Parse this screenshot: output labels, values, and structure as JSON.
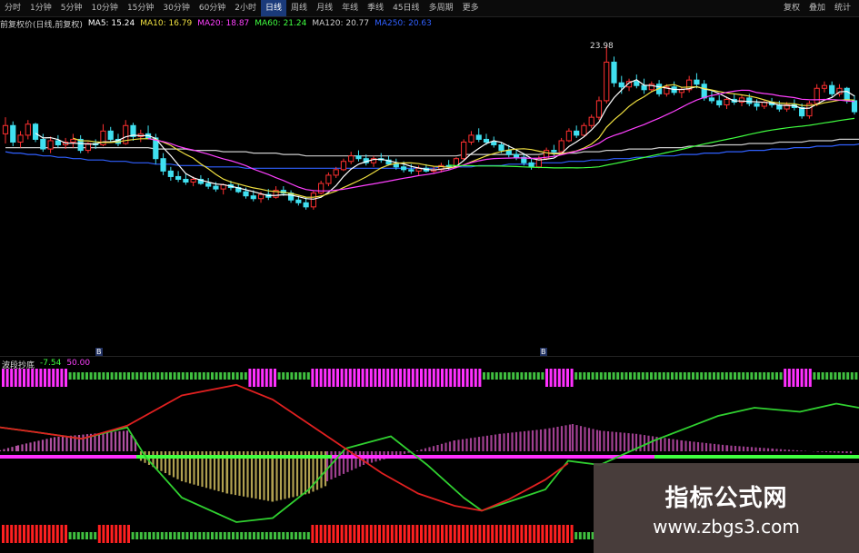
{
  "toolbar": {
    "items": [
      "分时",
      "1分钟",
      "5分钟",
      "10分钟",
      "15分钟",
      "30分钟",
      "60分钟",
      "2小时",
      "日线",
      "周线",
      "月线",
      "年线",
      "季线",
      "45日线",
      "多周期",
      "更多"
    ],
    "active_index": 8,
    "right_items": [
      "复权",
      "叠加",
      "统计"
    ]
  },
  "legend": {
    "title": "前复权价(日线,前复权)",
    "ma5": "MA5: 15.24",
    "ma10": "MA10: 16.79",
    "ma20": "MA20: 18.87",
    "ma60": "MA60: 21.24",
    "ma120": "MA120: 20.77",
    "ma250": "MA250: 20.63",
    "colors": {
      "ma5": "#ffffff",
      "ma10": "#f0e040",
      "ma20": "#ff40ff",
      "ma60": "#40ff40",
      "ma120": "#cccccc",
      "ma250": "#3060ff"
    }
  },
  "price_label": "23.98",
  "indicator": {
    "name": "波段抄底",
    "v1": "-7.54",
    "v2": "50.00",
    "flag1": "B",
    "flag2": "B"
  },
  "watermark": {
    "title": "指标公式网",
    "url": "www.zbgs3.com"
  },
  "chart_data": {
    "type": "candlestick",
    "note_series": [
      "candles",
      "ma5",
      "ma10",
      "ma20",
      "ma60",
      "ma250",
      "osc_red",
      "osc_green",
      "hist"
    ],
    "candles": [
      [
        17.6,
        18.8,
        16.9,
        18.2
      ],
      [
        18.2,
        18.5,
        16.7,
        17.0
      ],
      [
        17.0,
        17.8,
        16.6,
        17.5
      ],
      [
        17.5,
        18.6,
        17.2,
        18.3
      ],
      [
        18.3,
        18.4,
        17.0,
        17.2
      ],
      [
        17.2,
        17.6,
        16.3,
        16.5
      ],
      [
        16.5,
        17.4,
        16.2,
        17.1
      ],
      [
        17.1,
        17.5,
        16.6,
        16.8
      ],
      [
        16.8,
        17.3,
        16.5,
        17.0
      ],
      [
        17.0,
        17.6,
        16.6,
        17.2
      ],
      [
        17.2,
        17.5,
        16.2,
        16.4
      ],
      [
        16.4,
        17.0,
        16.2,
        16.9
      ],
      [
        16.9,
        17.2,
        16.5,
        16.8
      ],
      [
        16.8,
        18.3,
        16.7,
        17.8
      ],
      [
        17.8,
        18.1,
        17.0,
        17.2
      ],
      [
        17.2,
        17.6,
        16.7,
        16.9
      ],
      [
        16.9,
        18.6,
        16.8,
        18.2
      ],
      [
        18.2,
        18.4,
        17.1,
        17.4
      ],
      [
        17.4,
        17.9,
        17.0,
        17.6
      ],
      [
        17.6,
        18.2,
        17.2,
        17.3
      ],
      [
        17.3,
        17.6,
        15.4,
        15.8
      ],
      [
        15.8,
        16.2,
        14.6,
        14.9
      ],
      [
        14.9,
        15.2,
        14.2,
        14.5
      ],
      [
        14.5,
        14.9,
        14.1,
        14.3
      ],
      [
        14.3,
        14.7,
        13.9,
        14.1
      ],
      [
        14.1,
        14.5,
        13.8,
        14.3
      ],
      [
        14.3,
        14.6,
        13.9,
        14.0
      ],
      [
        14.0,
        14.4,
        13.6,
        13.8
      ],
      [
        13.8,
        14.1,
        13.4,
        13.6
      ],
      [
        13.6,
        14.0,
        13.2,
        13.9
      ],
      [
        13.9,
        14.2,
        13.5,
        13.7
      ],
      [
        13.7,
        14.0,
        13.3,
        13.4
      ],
      [
        13.4,
        13.7,
        12.9,
        13.1
      ],
      [
        13.1,
        13.5,
        12.7,
        12.9
      ],
      [
        12.9,
        13.4,
        12.6,
        13.2
      ],
      [
        13.2,
        13.6,
        12.8,
        13.0
      ],
      [
        13.0,
        13.8,
        12.9,
        13.5
      ],
      [
        13.5,
        13.8,
        13.1,
        13.3
      ],
      [
        13.3,
        13.5,
        12.6,
        12.8
      ],
      [
        12.8,
        13.1,
        12.4,
        12.6
      ],
      [
        12.6,
        13.0,
        12.1,
        12.3
      ],
      [
        12.3,
        13.5,
        12.1,
        13.3
      ],
      [
        13.3,
        14.2,
        13.2,
        14.0
      ],
      [
        14.0,
        14.8,
        13.8,
        14.6
      ],
      [
        14.6,
        15.2,
        14.4,
        15.0
      ],
      [
        15.0,
        15.8,
        14.9,
        15.6
      ],
      [
        15.6,
        16.3,
        15.4,
        16.0
      ],
      [
        16.0,
        16.4,
        15.6,
        15.8
      ],
      [
        15.8,
        16.1,
        15.3,
        15.5
      ],
      [
        15.5,
        16.0,
        15.2,
        15.8
      ],
      [
        15.8,
        16.2,
        15.5,
        15.7
      ],
      [
        15.7,
        16.0,
        15.3,
        15.4
      ],
      [
        15.4,
        15.8,
        15.0,
        15.2
      ],
      [
        15.2,
        15.6,
        14.8,
        15.0
      ],
      [
        15.0,
        15.4,
        14.7,
        14.9
      ],
      [
        14.9,
        15.3,
        14.6,
        15.1
      ],
      [
        15.1,
        15.4,
        14.8,
        14.9
      ],
      [
        14.9,
        15.2,
        14.7,
        15.0
      ],
      [
        15.0,
        15.5,
        14.8,
        15.3
      ],
      [
        15.3,
        15.7,
        15.0,
        15.2
      ],
      [
        15.2,
        15.9,
        15.1,
        15.8
      ],
      [
        15.8,
        17.2,
        15.7,
        17.0
      ],
      [
        17.0,
        17.8,
        16.8,
        17.5
      ],
      [
        17.5,
        18.0,
        17.0,
        17.2
      ],
      [
        17.2,
        17.6,
        16.8,
        17.0
      ],
      [
        17.0,
        17.4,
        16.6,
        16.8
      ],
      [
        16.8,
        17.0,
        16.2,
        16.4
      ],
      [
        16.4,
        16.8,
        15.9,
        16.1
      ],
      [
        16.1,
        16.5,
        15.7,
        15.9
      ],
      [
        15.9,
        16.2,
        15.3,
        15.5
      ],
      [
        15.5,
        15.8,
        15.0,
        15.2
      ],
      [
        15.2,
        16.0,
        15.1,
        15.8
      ],
      [
        15.8,
        16.6,
        15.7,
        16.4
      ],
      [
        16.4,
        16.8,
        16.0,
        16.3
      ],
      [
        16.3,
        17.3,
        16.2,
        17.1
      ],
      [
        17.1,
        18.0,
        17.0,
        17.8
      ],
      [
        17.8,
        18.2,
        17.3,
        17.5
      ],
      [
        17.5,
        18.4,
        17.4,
        18.2
      ],
      [
        18.2,
        19.0,
        18.0,
        18.8
      ],
      [
        18.8,
        20.3,
        18.6,
        20.0
      ],
      [
        20.0,
        23.98,
        19.8,
        22.8
      ],
      [
        22.8,
        23.2,
        21.0,
        21.3
      ],
      [
        21.3,
        21.8,
        20.5,
        21.0
      ],
      [
        21.0,
        21.6,
        20.7,
        21.4
      ],
      [
        21.4,
        21.9,
        20.9,
        21.1
      ],
      [
        21.1,
        21.6,
        20.5,
        20.8
      ],
      [
        20.8,
        21.4,
        20.6,
        21.2
      ],
      [
        21.2,
        21.5,
        20.3,
        20.5
      ],
      [
        20.5,
        21.2,
        20.3,
        21.0
      ],
      [
        21.0,
        21.4,
        20.4,
        20.6
      ],
      [
        20.6,
        21.0,
        20.2,
        20.8
      ],
      [
        20.8,
        21.8,
        20.6,
        21.5
      ],
      [
        21.5,
        22.0,
        20.9,
        21.2
      ],
      [
        21.2,
        21.5,
        20.0,
        20.2
      ],
      [
        20.2,
        20.7,
        19.8,
        20.0
      ],
      [
        20.0,
        20.4,
        19.5,
        19.7
      ],
      [
        19.7,
        20.3,
        19.4,
        20.1
      ],
      [
        20.1,
        20.5,
        19.7,
        19.9
      ],
      [
        19.9,
        20.4,
        19.6,
        20.2
      ],
      [
        20.2,
        20.5,
        19.6,
        19.8
      ],
      [
        19.8,
        20.1,
        19.3,
        19.6
      ],
      [
        19.6,
        20.0,
        19.4,
        19.9
      ],
      [
        19.9,
        20.2,
        19.5,
        19.7
      ],
      [
        19.7,
        20.0,
        19.2,
        19.4
      ],
      [
        19.4,
        19.9,
        19.2,
        19.7
      ],
      [
        19.7,
        20.1,
        19.3,
        19.5
      ],
      [
        19.5,
        19.8,
        18.7,
        18.9
      ],
      [
        18.9,
        20.0,
        18.7,
        19.8
      ],
      [
        19.8,
        21.2,
        19.6,
        20.9
      ],
      [
        20.9,
        21.4,
        20.6,
        21.1
      ],
      [
        21.1,
        21.4,
        20.3,
        20.5
      ],
      [
        20.5,
        21.2,
        20.3,
        20.9
      ],
      [
        20.9,
        21.0,
        19.8,
        20.0
      ],
      [
        20.0,
        20.4,
        19.0,
        19.2
      ]
    ],
    "ma250": [
      16.3,
      16.2,
      16.2,
      16.1,
      16.1,
      16.0,
      16.0,
      15.9,
      15.9,
      15.8,
      15.8,
      15.7,
      15.7,
      15.7,
      15.6,
      15.6,
      15.6,
      15.5,
      15.5,
      15.5,
      15.4,
      15.4,
      15.4,
      15.3,
      15.3,
      15.3,
      15.3,
      15.2,
      15.2,
      15.2,
      15.2,
      15.2,
      15.1,
      15.1,
      15.1,
      15.1,
      15.1,
      15.1,
      15.1,
      15.1,
      15.1,
      15.1,
      15.1,
      15.1,
      15.1,
      15.1,
      15.1,
      15.1,
      15.1,
      15.1,
      15.1,
      15.1,
      15.1,
      15.1,
      15.1,
      15.1,
      15.1,
      15.1,
      15.2,
      15.2,
      15.2,
      15.2,
      15.2,
      15.3,
      15.3,
      15.3,
      15.3,
      15.4,
      15.4,
      15.4,
      15.4,
      15.5,
      15.5,
      15.5,
      15.5,
      15.6,
      15.6,
      15.6,
      15.7,
      15.7,
      15.7,
      15.8,
      15.8,
      15.8,
      15.9,
      15.9,
      15.9,
      16.0,
      16.0,
      16.0,
      16.1,
      16.1,
      16.1,
      16.2,
      16.2,
      16.2,
      16.3,
      16.3,
      16.3,
      16.4,
      16.4,
      16.4,
      16.5,
      16.5,
      16.5,
      16.6,
      16.6,
      16.6,
      16.7,
      16.7,
      16.7,
      16.8,
      16.8,
      16.8,
      16.9
    ],
    "ma120": [
      16.6,
      16.6,
      16.6,
      16.6,
      16.6,
      16.6,
      16.6,
      16.6,
      16.6,
      16.6,
      16.6,
      16.6,
      16.6,
      16.6,
      16.6,
      16.6,
      16.6,
      16.6,
      16.6,
      16.6,
      16.5,
      16.5,
      16.5,
      16.5,
      16.5,
      16.4,
      16.4,
      16.4,
      16.4,
      16.3,
      16.3,
      16.3,
      16.3,
      16.2,
      16.2,
      16.2,
      16.2,
      16.1,
      16.1,
      16.1,
      16.0,
      16.0,
      16.0,
      16.0,
      16.0,
      16.0,
      16.0,
      16.0,
      16.0,
      16.0,
      16.0,
      16.0,
      16.0,
      16.0,
      16.0,
      16.0,
      16.0,
      16.0,
      16.0,
      16.0,
      16.0,
      16.1,
      16.1,
      16.1,
      16.1,
      16.1,
      16.1,
      16.1,
      16.1,
      16.1,
      16.1,
      16.1,
      16.2,
      16.2,
      16.2,
      16.2,
      16.2,
      16.3,
      16.3,
      16.3,
      16.4,
      16.4,
      16.4,
      16.5,
      16.5,
      16.5,
      16.5,
      16.6,
      16.6,
      16.6,
      16.6,
      16.7,
      16.7,
      16.7,
      16.7,
      16.8,
      16.8,
      16.8,
      16.8,
      16.9,
      16.9,
      16.9,
      16.9,
      17.0,
      17.0,
      17.0,
      17.0,
      17.1,
      17.1,
      17.1,
      17.1,
      17.2,
      17.2,
      17.2,
      17.2
    ],
    "osc_red": [
      [
        0,
        36
      ],
      [
        40,
        30
      ],
      [
        90,
        22
      ],
      [
        140,
        38
      ],
      [
        200,
        75
      ],
      [
        260,
        88
      ],
      [
        300,
        70
      ],
      [
        340,
        40
      ],
      [
        380,
        10
      ],
      [
        420,
        -20
      ],
      [
        460,
        -45
      ],
      [
        500,
        -60
      ],
      [
        530,
        -66
      ],
      [
        560,
        -52
      ],
      [
        600,
        -28
      ],
      [
        625,
        -8
      ]
    ],
    "osc_green": [
      [
        0,
        36
      ],
      [
        40,
        30
      ],
      [
        90,
        22
      ],
      [
        140,
        36
      ],
      [
        160,
        0
      ],
      [
        200,
        -50
      ],
      [
        260,
        -80
      ],
      [
        300,
        -75
      ],
      [
        340,
        -40
      ],
      [
        380,
        10
      ],
      [
        430,
        25
      ],
      [
        470,
        -10
      ],
      [
        510,
        -50
      ],
      [
        530,
        -66
      ],
      [
        560,
        -55
      ],
      [
        600,
        -40
      ],
      [
        625,
        -5
      ],
      [
        660,
        -10
      ],
      [
        720,
        20
      ],
      [
        790,
        50
      ],
      [
        830,
        60
      ],
      [
        880,
        55
      ],
      [
        920,
        65
      ],
      [
        945,
        60
      ]
    ],
    "hist_pos": [
      [
        0,
        8
      ],
      [
        20,
        14
      ],
      [
        60,
        24
      ],
      [
        100,
        28
      ],
      [
        140,
        32
      ],
      [
        150,
        20
      ]
    ],
    "hist_neg": [
      [
        155,
        -5
      ],
      [
        200,
        -30
      ],
      [
        250,
        -45
      ],
      [
        300,
        -55
      ],
      [
        340,
        -45
      ],
      [
        360,
        -35
      ]
    ],
    "hist_pos2": [
      [
        360,
        -30
      ],
      [
        400,
        -10
      ],
      [
        450,
        5
      ],
      [
        500,
        20
      ],
      [
        550,
        28
      ],
      [
        600,
        34
      ],
      [
        630,
        40
      ],
      [
        660,
        32
      ],
      [
        700,
        28
      ],
      [
        750,
        20
      ],
      [
        800,
        14
      ],
      [
        850,
        10
      ],
      [
        900,
        6
      ],
      [
        940,
        4
      ]
    ]
  }
}
